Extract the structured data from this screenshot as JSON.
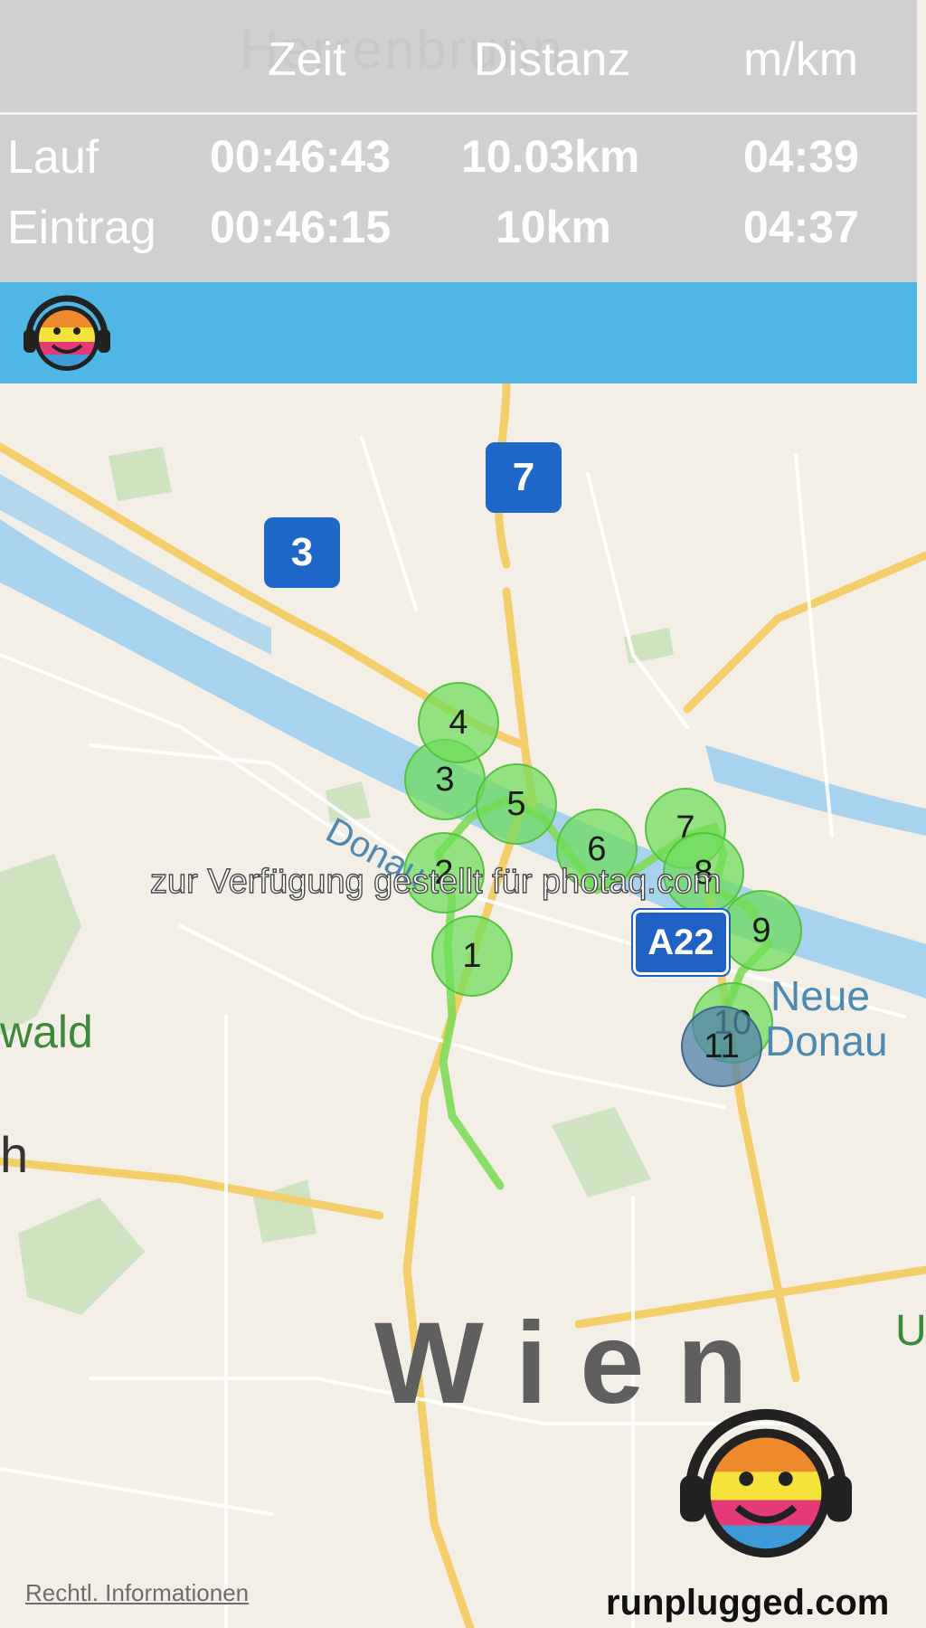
{
  "stats": {
    "ghost_text": "Herrenbrunn",
    "columns": [
      "Zeit",
      "Distanz",
      "m/km"
    ],
    "rows": [
      {
        "label": "Lauf",
        "time": "00:46:43",
        "distance": "10.03km",
        "pace": "04:39"
      },
      {
        "label": "Eintrag",
        "time": "00:46:15",
        "distance": "10km",
        "pace": "04:37"
      }
    ]
  },
  "map": {
    "transit_badges": [
      "7",
      "3"
    ],
    "highway_badge": "A22",
    "labels": {
      "donau": "Donau",
      "neue": "Neue",
      "donau2": "Donau",
      "wald": "wald",
      "h": "h",
      "u": "U",
      "city": "Wien",
      "legal": "Rechtl. Informationen"
    },
    "splits": [
      "1",
      "2",
      "3",
      "4",
      "5",
      "6",
      "7",
      "8",
      "9",
      "10",
      "11"
    ],
    "watermark": "zur Verfügung gestellt für photaq.com",
    "brand": "runplugged.com"
  },
  "colors": {
    "header_bg": "#d0d0d0",
    "bar_blue": "#4fb6e6",
    "route_green": "#6edc5a",
    "transit_blue": "#1e67c9",
    "river": "#a7d3ee"
  },
  "icons": [
    "runplugged-logo-icon"
  ]
}
